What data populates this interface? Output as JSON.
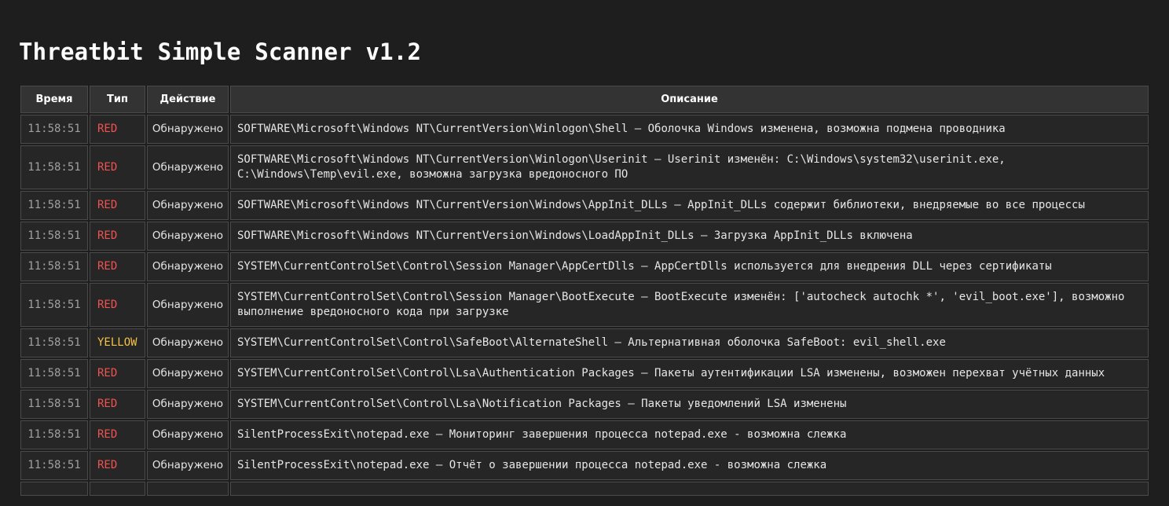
{
  "title": "Threatbit Simple Scanner v1.2",
  "columns": {
    "time": "Время",
    "type": "Тип",
    "action": "Действие",
    "description": "Описание"
  },
  "colors": {
    "red": "#ef5350",
    "yellow": "#f5c242",
    "background": "#1e1e1e"
  },
  "rows": [
    {
      "time": "11:58:51",
      "type": "RED",
      "action": "Обнаружено",
      "description": "SOFTWARE\\Microsoft\\Windows NT\\CurrentVersion\\Winlogon\\Shell — Оболочка Windows изменена, возможна подмена проводника"
    },
    {
      "time": "11:58:51",
      "type": "RED",
      "action": "Обнаружено",
      "description": "SOFTWARE\\Microsoft\\Windows NT\\CurrentVersion\\Winlogon\\Userinit — Userinit изменён: C:\\Windows\\system32\\userinit.exe, C:\\Windows\\Temp\\evil.exe, возможна загрузка вредоносного ПО"
    },
    {
      "time": "11:58:51",
      "type": "RED",
      "action": "Обнаружено",
      "description": "SOFTWARE\\Microsoft\\Windows NT\\CurrentVersion\\Windows\\AppInit_DLLs — AppInit_DLLs содержит библиотеки, внедряемые во все процессы"
    },
    {
      "time": "11:58:51",
      "type": "RED",
      "action": "Обнаружено",
      "description": "SOFTWARE\\Microsoft\\Windows NT\\CurrentVersion\\Windows\\LoadAppInit_DLLs — Загрузка AppInit_DLLs включена"
    },
    {
      "time": "11:58:51",
      "type": "RED",
      "action": "Обнаружено",
      "description": "SYSTEM\\CurrentControlSet\\Control\\Session Manager\\AppCertDlls — AppCertDlls используется для внедрения DLL через сертификаты"
    },
    {
      "time": "11:58:51",
      "type": "RED",
      "action": "Обнаружено",
      "description": "SYSTEM\\CurrentControlSet\\Control\\Session Manager\\BootExecute — BootExecute изменён: ['autocheck autochk *', 'evil_boot.exe'], возможно выполнение вредоносного кода при загрузке"
    },
    {
      "time": "11:58:51",
      "type": "YELLOW",
      "action": "Обнаружено",
      "description": "SYSTEM\\CurrentControlSet\\Control\\SafeBoot\\AlternateShell — Альтернативная оболочка SafeBoot: evil_shell.exe"
    },
    {
      "time": "11:58:51",
      "type": "RED",
      "action": "Обнаружено",
      "description": "SYSTEM\\CurrentControlSet\\Control\\Lsa\\Authentication Packages — Пакеты аутентификации LSA изменены, возможен перехват учётных данных"
    },
    {
      "time": "11:58:51",
      "type": "RED",
      "action": "Обнаружено",
      "description": "SYSTEM\\CurrentControlSet\\Control\\Lsa\\Notification Packages — Пакеты уведомлений LSA изменены"
    },
    {
      "time": "11:58:51",
      "type": "RED",
      "action": "Обнаружено",
      "description": "SilentProcessExit\\notepad.exe — Мониторинг завершения процесса notepad.exe - возможна слежка"
    },
    {
      "time": "11:58:51",
      "type": "RED",
      "action": "Обнаружено",
      "description": "SilentProcessExit\\notepad.exe — Отчёт о завершении процесса notepad.exe - возможна слежка"
    },
    {
      "time": "",
      "type": "",
      "action": "",
      "description": ""
    }
  ]
}
